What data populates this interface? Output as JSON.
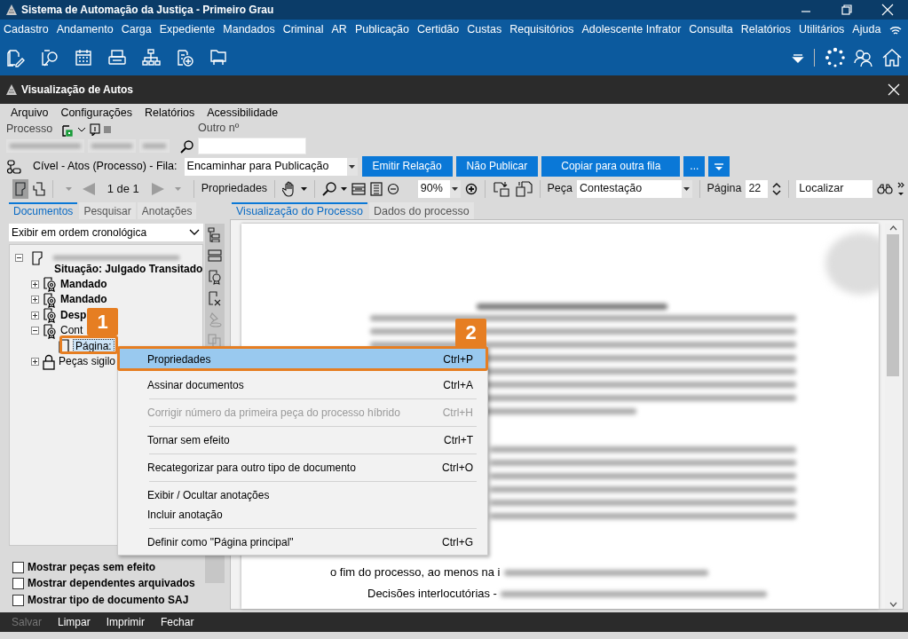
{
  "app": {
    "title": "Sistema de Automação da Justiça - Primeiro Grau"
  },
  "main_menu": [
    "Cadastro",
    "Andamento",
    "Carga",
    "Expediente",
    "Mandados",
    "Criminal",
    "AR",
    "Publicação",
    "Certidão",
    "Custas",
    "Requisitórios",
    "Adolescente Infrator",
    "Consulta",
    "Relatórios",
    "Utilitários",
    "Ajuda"
  ],
  "window": {
    "title": "Visualização de Autos"
  },
  "menu": [
    "Arquivo",
    "Configurações",
    "Relatórios",
    "Acessibilidade"
  ],
  "process": {
    "label": "Processo",
    "other_label": "Outro nº"
  },
  "queue": {
    "label": "Cível - Atos (Processo) - Fila:",
    "value": "Encaminhar para Publicação",
    "buttons": [
      "Emitir Relação",
      "Não Publicar",
      "Copiar para outra fila",
      "..."
    ]
  },
  "toolbar": {
    "page_count": "1 de 1",
    "properties": "Propriedades",
    "zoom": "90%",
    "piece_label": "Peça",
    "piece": "Contestação",
    "page_label": "Página",
    "page": "22",
    "find": "Localizar"
  },
  "left_tabs": [
    {
      "label": "Documentos",
      "selected": true
    },
    {
      "label": "Pesquisar",
      "selected": false
    },
    {
      "label": "Anotações",
      "selected": false
    }
  ],
  "order": "Exibir em ordem cronológica",
  "tree": {
    "status": "Situação: Julgado Transitado",
    "expanded": true,
    "children": [
      {
        "label": "Mandado",
        "kind": "seal",
        "bold": true,
        "expanded": false
      },
      {
        "label": "Mandado",
        "kind": "seal",
        "bold": true,
        "expanded": false
      },
      {
        "label": "Desp",
        "kind": "seal",
        "bold": true,
        "expanded": false
      },
      {
        "label": "Cont",
        "kind": "seal",
        "bold": false,
        "expanded": true,
        "children": [
          {
            "label": "Página:",
            "kind": "page",
            "bold": false,
            "selected": true
          }
        ]
      },
      {
        "label": "Peças sigilo",
        "kind": "lock",
        "bold": false,
        "expanded": false
      }
    ]
  },
  "options": [
    {
      "label": "Mostrar peças sem efeito",
      "checked": false
    },
    {
      "label": "Mostrar dependentes arquivados",
      "checked": false
    },
    {
      "label": "Mostrar tipo de documento SAJ",
      "checked": false
    }
  ],
  "viewer_tabs": [
    {
      "label": "Visualização do Processo",
      "selected": true
    },
    {
      "label": "Dados do processo",
      "selected": false
    }
  ],
  "document": {
    "lines": [
      "o fim do processo, ao menos na i",
      "Decisões interlocutórias -"
    ]
  },
  "context_menu": [
    {
      "kind": "item",
      "label": "Propriedades",
      "shortcut": "Ctrl+P",
      "selected": true,
      "disabled": false
    },
    {
      "kind": "item",
      "label": "Assinar documentos",
      "shortcut": "Ctrl+A",
      "selected": false,
      "disabled": false
    },
    {
      "kind": "separator"
    },
    {
      "kind": "item",
      "label": "Corrigir número da primeira peça do processo híbrido",
      "shortcut": "Ctrl+H",
      "selected": false,
      "disabled": true
    },
    {
      "kind": "separator"
    },
    {
      "kind": "item",
      "label": "Tornar sem efeito",
      "shortcut": "Ctrl+T",
      "selected": false,
      "disabled": false
    },
    {
      "kind": "separator"
    },
    {
      "kind": "item",
      "label": "Recategorizar para outro tipo de documento",
      "shortcut": "Ctrl+O",
      "selected": false,
      "disabled": false
    },
    {
      "kind": "separator"
    },
    {
      "kind": "item",
      "label": "Exibir / Ocultar anotações",
      "selected": false,
      "disabled": false
    },
    {
      "kind": "item",
      "label": "Incluir anotação",
      "selected": false,
      "disabled": false
    },
    {
      "kind": "separator"
    },
    {
      "kind": "item",
      "label": "Definir como \"Página principal\"",
      "shortcut": "Ctrl+G",
      "selected": false,
      "disabled": false
    }
  ],
  "callouts": [
    "1",
    "2"
  ],
  "footer": [
    {
      "label": "Salvar",
      "disabled": true
    },
    {
      "label": "Limpar",
      "disabled": false
    },
    {
      "label": "Imprimir",
      "disabled": false
    },
    {
      "label": "Fechar",
      "disabled": false
    }
  ]
}
